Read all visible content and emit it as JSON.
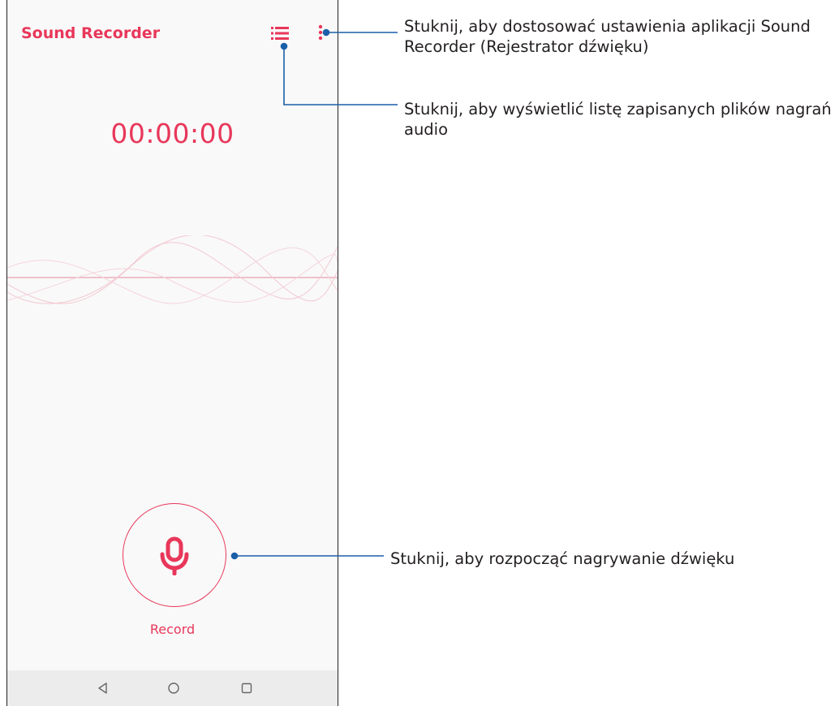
{
  "colors": {
    "accent": "#e8375a",
    "callout_line": "#1a5fa8",
    "text_dark": "#231f20",
    "nav_icon": "#666666"
  },
  "app": {
    "title": "Sound Recorder",
    "list_icon": "list-icon",
    "menu_icon": "more-vertical-icon",
    "timer": "00:00:00",
    "record_icon": "microphone-icon",
    "record_label": "Record"
  },
  "navbar": {
    "back_icon": "back-triangle-icon",
    "home_icon": "home-circle-icon",
    "recent_icon": "recent-square-icon"
  },
  "callouts": {
    "settings": "Stuknij, aby dostosować ustawienia aplikacji Sound Recorder (Rejestrator dźwięku)",
    "list": "Stuknij, aby wyświetlić listę zapisanych plików nagrań audio",
    "record": "Stuknij, aby rozpocząć nagrywanie dźwięku"
  }
}
